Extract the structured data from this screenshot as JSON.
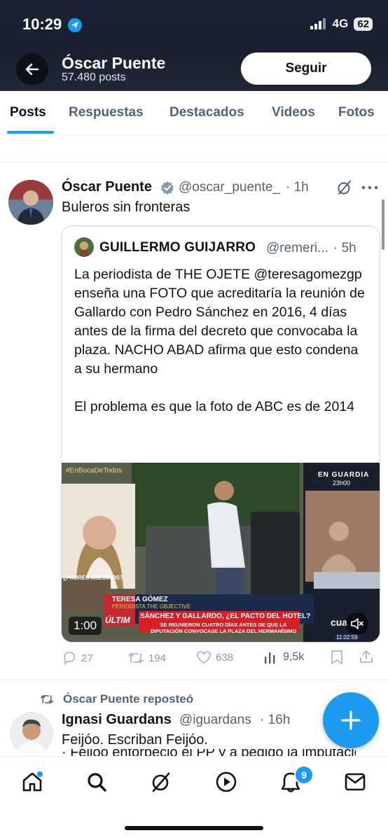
{
  "status_bar": {
    "time": "10:29",
    "network": "4G",
    "battery": "62"
  },
  "header": {
    "name": "Óscar Puente",
    "posts_count": "57.480 posts",
    "follow_label": "Seguir"
  },
  "tabs": [
    {
      "label": "Posts",
      "active": true
    },
    {
      "label": "Respuestas"
    },
    {
      "label": "Destacados"
    },
    {
      "label": "Videos"
    },
    {
      "label": "Fotos"
    }
  ],
  "tweet": {
    "author": "Óscar Puente",
    "handle": "@oscar_puente_",
    "time": "· 1h",
    "text": "Buleros sin fronteras",
    "quote": {
      "author": "GUILLERMO GUIJARRO",
      "handle": "@remeri...",
      "time": "· 5h",
      "paragraph1": "La periodista de THE OJETE @teresagomezgp enseña una FOTO que acreditaría la reunión de Gallardo con Pedro Sánchez en 2016, 4 días antes de la firma del decreto que convocaba la plaza. NACHO ABAD afirma que esto condena a su hermano",
      "paragraph2": "El problema es que la foto de ABC es de 2014",
      "video": {
        "duration": "1:00",
        "tag": "#EnBocaDeTodos",
        "show": "EN GUARDIA",
        "show_time": "23h00",
        "name_tag": "TERESA GÓMEZ",
        "name_role": "PERIODISTA THE OBJECTIVE",
        "headline": "SÁNCHEZ Y GALLARDO, ¿EL PACTO DEL HOTEL?",
        "subheadline": "SE REUNIERON CUATRO DÍAS ANTES DE QUE LA DIPUTACIÓN CONVOCASE LA PLAZA DEL HERMANÍSIMO",
        "side_label": "¿PADRES ASESINOS?",
        "ultima": "ÚLTIM",
        "clock": "11:02:59",
        "channel": "cua"
      }
    },
    "stats": {
      "replies": "27",
      "reposts": "194",
      "likes": "638",
      "views": "9,5k"
    }
  },
  "repost": {
    "label": "Óscar Puente reposteó",
    "author": "Ignasi Guardans",
    "handle": "@iguardans",
    "time": "· 16h",
    "text": "Feijóo. Escriban Feijóo.",
    "text_cut": "· Feijóo entorpeció el PP y a pedido la imputación"
  },
  "nav": {
    "notifications_badge": "9"
  },
  "colors": {
    "accent": "#1d9bf0",
    "header_bg": "#1b2234"
  }
}
